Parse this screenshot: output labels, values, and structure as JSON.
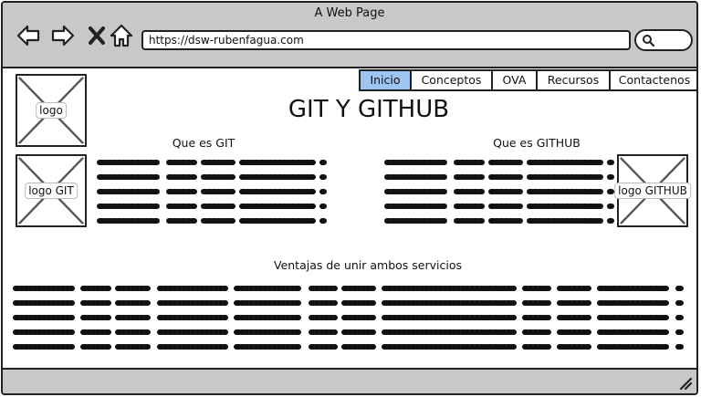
{
  "window": {
    "title": "A Web Page"
  },
  "address_bar": {
    "url": "https://dsw-rubenfagua.com"
  },
  "nav_icons": [
    "back-arrow-icon",
    "forward-arrow-icon",
    "close-x-icon",
    "home-icon",
    "search-icon"
  ],
  "menu": {
    "items": [
      {
        "label": "Inicio",
        "active": true
      },
      {
        "label": "Conceptos",
        "active": false
      },
      {
        "label": "OVA",
        "active": false
      },
      {
        "label": "Recursos",
        "active": false
      },
      {
        "label": "Contactenos",
        "active": false
      }
    ]
  },
  "images": {
    "logo": "logo",
    "logo_git": "logo GIT",
    "logo_github": "logo GITHUB"
  },
  "page": {
    "title": "GIT Y GITHUB",
    "git_heading": "Que es GIT",
    "github_heading": "Que es GITHUB",
    "advantages_heading": "Ventajas de unir ambos servicios"
  },
  "colors": {
    "active_tab": "#9ec4f2",
    "chrome": "#c8c8c8"
  }
}
